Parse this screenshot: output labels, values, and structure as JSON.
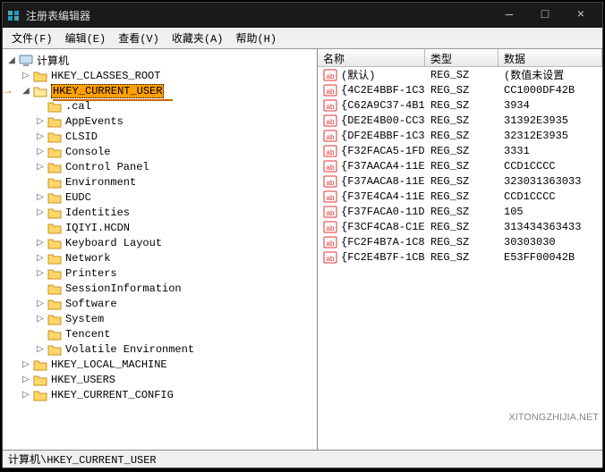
{
  "window": {
    "title": "注册表编辑器",
    "buttons": {
      "min": "—",
      "max": "□",
      "close": "×"
    }
  },
  "menu": [
    {
      "label": "文件(F)"
    },
    {
      "label": "编辑(E)"
    },
    {
      "label": "查看(V)"
    },
    {
      "label": "收藏夹(A)"
    },
    {
      "label": "帮助(H)"
    }
  ],
  "tree": {
    "root": "计算机",
    "hkcr": "HKEY_CLASSES_ROOT",
    "hkcu": "HKEY_CURRENT_USER",
    "hklm": "HKEY_LOCAL_MACHINE",
    "hku": "HKEY_USERS",
    "hkcc": "HKEY_CURRENT_CONFIG",
    "children": [
      ".cal",
      "AppEvents",
      "CLSID",
      "Console",
      "Control Panel",
      "Environment",
      "EUDC",
      "Identities",
      "IQIYI.HCDN",
      "Keyboard Layout",
      "Network",
      "Printers",
      "SessionInformation",
      "Software",
      "System",
      "Tencent",
      "Volatile Environment"
    ]
  },
  "columns": {
    "name": "名称",
    "type": "类型",
    "data": "数据"
  },
  "values": [
    {
      "icon": "string",
      "name": "(默认)",
      "type": "REG_SZ",
      "data": "(数值未设置"
    },
    {
      "icon": "string",
      "name": "{4C2E4BBF-1C3...",
      "type": "REG_SZ",
      "data": "CC1000DF42B"
    },
    {
      "icon": "string",
      "name": "{C62A9C37-4B1...",
      "type": "REG_SZ",
      "data": "3934"
    },
    {
      "icon": "string",
      "name": "{DE2E4B00-CC3...",
      "type": "REG_SZ",
      "data": "31392E3935"
    },
    {
      "icon": "string",
      "name": "{DF2E4BBF-1C3...",
      "type": "REG_SZ",
      "data": "32312E3935"
    },
    {
      "icon": "string",
      "name": "{F32FACA5-1FD...",
      "type": "REG_SZ",
      "data": "3331"
    },
    {
      "icon": "string",
      "name": "{F37AACA4-11E...",
      "type": "REG_SZ",
      "data": "CCD1CCCC"
    },
    {
      "icon": "string",
      "name": "{F37AACA8-11E...",
      "type": "REG_SZ",
      "data": "323031363033"
    },
    {
      "icon": "string",
      "name": "{F37E4CA4-11E...",
      "type": "REG_SZ",
      "data": "CCD1CCCC"
    },
    {
      "icon": "string",
      "name": "{F37FACA0-11D...",
      "type": "REG_SZ",
      "data": "105"
    },
    {
      "icon": "string",
      "name": "{F3CF4CA8-C1E...",
      "type": "REG_SZ",
      "data": "313434363433"
    },
    {
      "icon": "string",
      "name": "{FC2F4B7A-1C8...",
      "type": "REG_SZ",
      "data": "30303030"
    },
    {
      "icon": "string",
      "name": "{FC2E4B7F-1CB...",
      "type": "REG_SZ",
      "data": "E53FF00042B"
    }
  ],
  "status": "计算机\\HKEY_CURRENT_USER",
  "watermark": "XITONGZHIJIA.NET"
}
